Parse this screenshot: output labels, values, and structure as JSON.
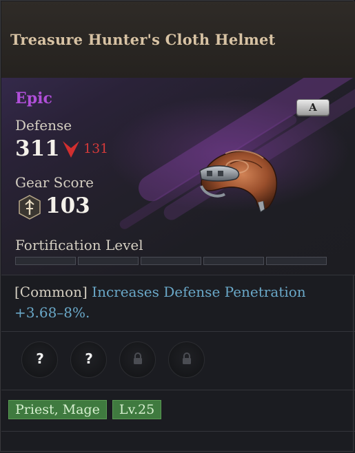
{
  "item": {
    "name": "Treasure Hunter's Cloth Helmet",
    "grade": "Epic",
    "tier_badge": "A"
  },
  "stats": {
    "defense_label": "Defense",
    "defense_value": "311",
    "defense_delta": "131",
    "gear_score_label": "Gear Score",
    "gear_score_value": "103",
    "fortification_label": "Fortification Level",
    "fortification_segments_filled": 0,
    "fortification_segments_total": 5
  },
  "effect": {
    "prefix": "[Common]",
    "text": "Increases Defense Penetration",
    "value": "+3.68–8%."
  },
  "sockets": [
    {
      "state": "unknown",
      "glyph": "?"
    },
    {
      "state": "unknown",
      "glyph": "?"
    },
    {
      "state": "locked"
    },
    {
      "state": "locked"
    }
  ],
  "tags": {
    "classes": "Priest, Mage",
    "level": "Lv.25"
  },
  "colors": {
    "epic": "#b04fd8",
    "decrease": "#d33a3a",
    "effect_highlight": "#6aa8c8",
    "tag_green": "#3f7a3f"
  },
  "icons": {
    "defense_change": "red-down-arrow-icon",
    "gear_score": "gear-score-sword-icon",
    "socket_unknown": "question-icon",
    "socket_locked": "lock-icon"
  }
}
